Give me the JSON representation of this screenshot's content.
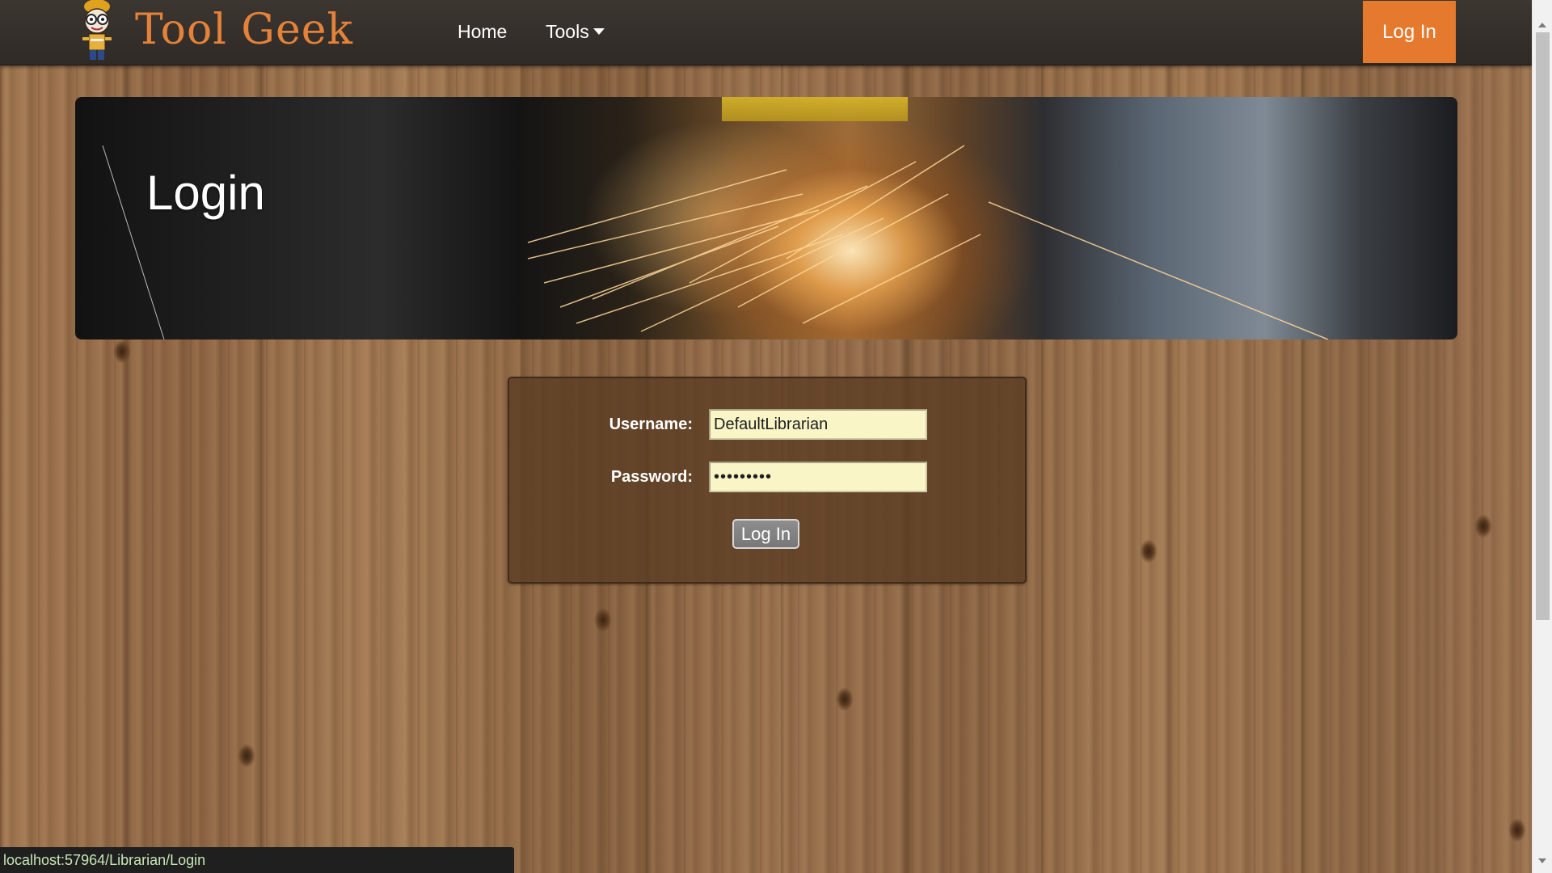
{
  "navbar": {
    "brand": "Tool Geek",
    "logo_icon": "geek-mascot-icon",
    "links": [
      {
        "label": "Home"
      },
      {
        "label": "Tools"
      }
    ],
    "tools_caret_icon": "caret-down-icon",
    "login_label": "Log In",
    "accent_color": "#e5792e"
  },
  "hero": {
    "title": "Login"
  },
  "form": {
    "username_label": "Username:",
    "username_value": "DefaultLibrarian",
    "password_label": "Password:",
    "password_value": "•••••••••",
    "submit_label": "Log In"
  },
  "status_bar": {
    "url": "localhost:57964/Librarian/Login"
  }
}
